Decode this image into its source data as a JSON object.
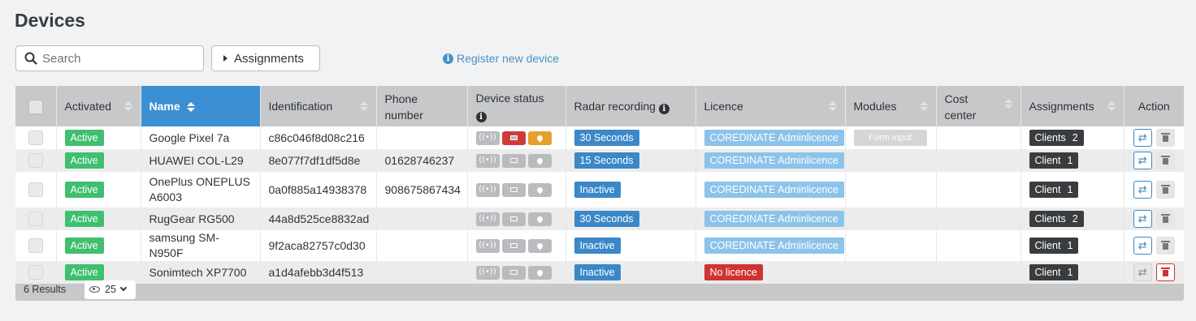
{
  "page": {
    "title": "Devices"
  },
  "toolbar": {
    "search_placeholder": "Search",
    "assignments_label": "Assignments",
    "register_label": "Register new device"
  },
  "table": {
    "headers": {
      "activated": "Activated",
      "name": "Name",
      "identification": "Identification",
      "phone": "Phone number",
      "device_status": "Device status",
      "radar_recording": "Radar recording",
      "licence": "Licence",
      "modules": "Modules",
      "cost_center": "Cost center",
      "assignments": "Assignments",
      "action": "Action"
    },
    "sorted_column": "Name",
    "rows": [
      {
        "activated": "Active",
        "name": "Google Pixel 7a",
        "identification": "c86c046f8d08c216",
        "phone": "",
        "status": "active",
        "radar": "30 Seconds",
        "licence": "COREDINATE Adminlicence",
        "module": "Form input",
        "cost_center": "",
        "assign_label": "Clients",
        "assign_count": "2"
      },
      {
        "activated": "Active",
        "name": "HUAWEI COL-L29",
        "identification": "8e077f7df1df5d8e",
        "phone": "01628746237",
        "status": "inactive",
        "radar": "15 Seconds",
        "licence": "COREDINATE Adminlicence",
        "module": "",
        "cost_center": "",
        "assign_label": "Client",
        "assign_count": "1"
      },
      {
        "activated": "Active",
        "name": "OnePlus ONEPLUS A6003",
        "identification": "0a0f885a14938378",
        "phone": "908675867434",
        "status": "inactive",
        "radar": "Inactive",
        "licence": "COREDINATE Adminlicence",
        "module": "",
        "cost_center": "",
        "assign_label": "Client",
        "assign_count": "1"
      },
      {
        "activated": "Active",
        "name": "RugGear RG500",
        "identification": "44a8d525ce8832ad",
        "phone": "",
        "status": "inactive",
        "radar": "30 Seconds",
        "licence": "COREDINATE Adminlicence",
        "module": "",
        "cost_center": "",
        "assign_label": "Clients",
        "assign_count": "2"
      },
      {
        "activated": "Active",
        "name": "samsung SM-N950F",
        "identification": "9f2aca82757c0d30",
        "phone": "",
        "status": "inactive",
        "radar": "Inactive",
        "licence": "COREDINATE Adminlicence",
        "module": "",
        "cost_center": "",
        "assign_label": "Client",
        "assign_count": "1"
      },
      {
        "activated": "Active",
        "name": "Sonimtech XP7700",
        "identification": "a1d4afebb3d4f513",
        "phone": "",
        "status": "inactive",
        "radar": "Inactive",
        "licence": "No licence",
        "module": "",
        "cost_center": "",
        "assign_label": "Client",
        "assign_count": "1"
      }
    ]
  },
  "footer": {
    "results": "6 Results",
    "per_page": "25"
  },
  "colors": {
    "accent": "#3d8fd4",
    "active_green": "#3fbf6f",
    "radar_blue": "#3b88c8",
    "licence_light_blue": "#8cc3ea",
    "no_licence_red": "#cf3333",
    "status_orange": "#e5a02c",
    "status_red": "#d23a3a",
    "assignment_dark": "#3a3d40"
  },
  "icons": {
    "search": "search-icon",
    "caret": "caret-right-icon",
    "info": "info-icon",
    "signal": "signal-icon",
    "battery": "battery-icon",
    "location": "location-pin-icon",
    "swap": "swap-icon",
    "trash": "trash-icon",
    "eye": "eye-icon"
  }
}
